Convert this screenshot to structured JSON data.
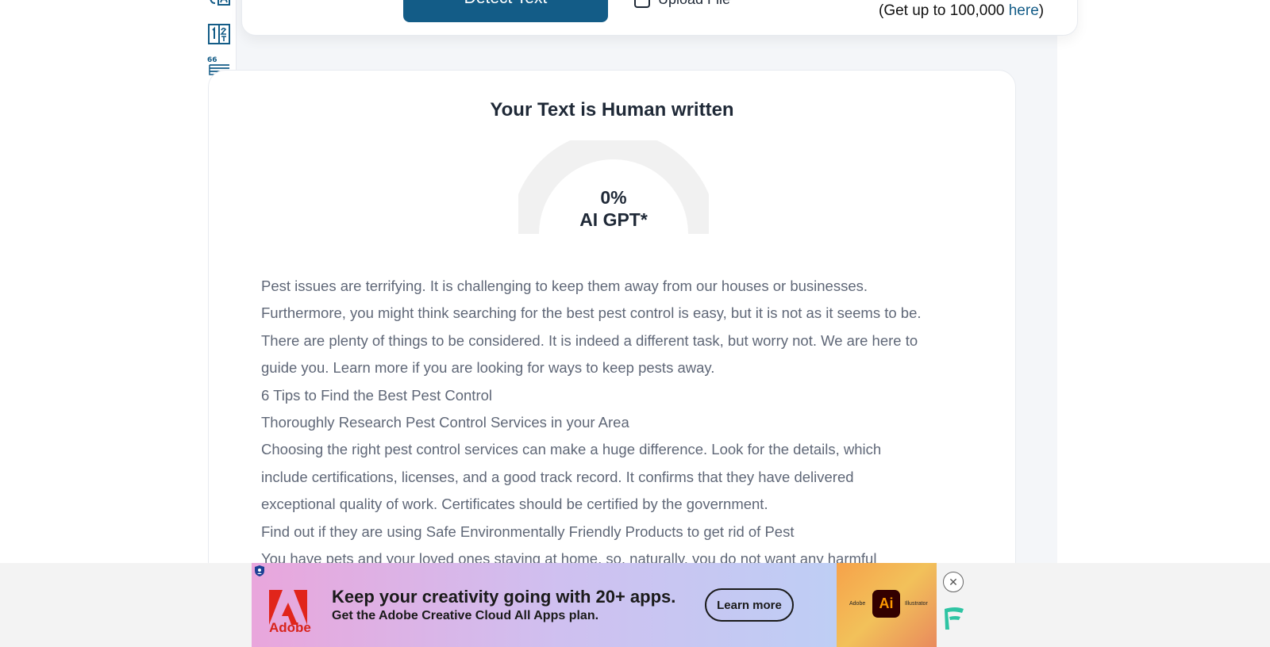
{
  "top_card": {
    "detect_button": "Detect Text",
    "upload_label": "Upload File",
    "limit_prefix": "(Get up to 100,000 ",
    "limit_link": "here",
    "limit_suffix": ")"
  },
  "result": {
    "title": "Your Text is Human written",
    "gauge": {
      "percent_label": "0%",
      "type_label": "AI GPT*",
      "ai_fraction": 0
    },
    "paragraphs": [
      "Pest issues are terrifying. It is challenging to keep them away from our houses or businesses.",
      "Furthermore, you might think searching for the best pest control is easy, but it is not as it seems to be.",
      "There are plenty of things to be considered. It is indeed a different task, but worry not. We are here to",
      "guide you. Learn more if you are looking for ways to keep pests away.",
      "6 Tips to Find the Best Pest Control",
      "Thoroughly Research Pest Control Services in your Area",
      "Choosing the right pest control services can make a huge difference. Look for the details, which",
      "include certifications, licenses, and a good track record. It confirms that they have delivered",
      "exceptional quality of work. Certificates should be certified by the government.",
      "Find out if they are using Safe Environmentally Friendly Products to get rid of Pest",
      "You have pets and your loved ones staying at home, so, naturally, you do not want any harmful"
    ]
  },
  "ad": {
    "brand": "Adobe",
    "headline": "Keep your creativity going with 20+ apps.",
    "subline": "Get the Adobe Creative Cloud All Apps plan.",
    "cta": "Learn more",
    "side_left_word": "Adobe",
    "side_badge": "Ai",
    "side_right_word": "Illustrator",
    "info_glyph": "ⓘ",
    "close_glyph": "✕"
  },
  "overlay": {
    "close_glyph": "✕"
  },
  "icons": [
    "translate-icon",
    "fraction-icon",
    "quote-icon",
    "upload-file-icon",
    "privacy-shield-icon",
    "close-circle-icon",
    "freestar-icon"
  ],
  "colors": {
    "primary": "#135c87",
    "text_muted": "#5f6777",
    "gauge_track": "#f1f1f1"
  }
}
